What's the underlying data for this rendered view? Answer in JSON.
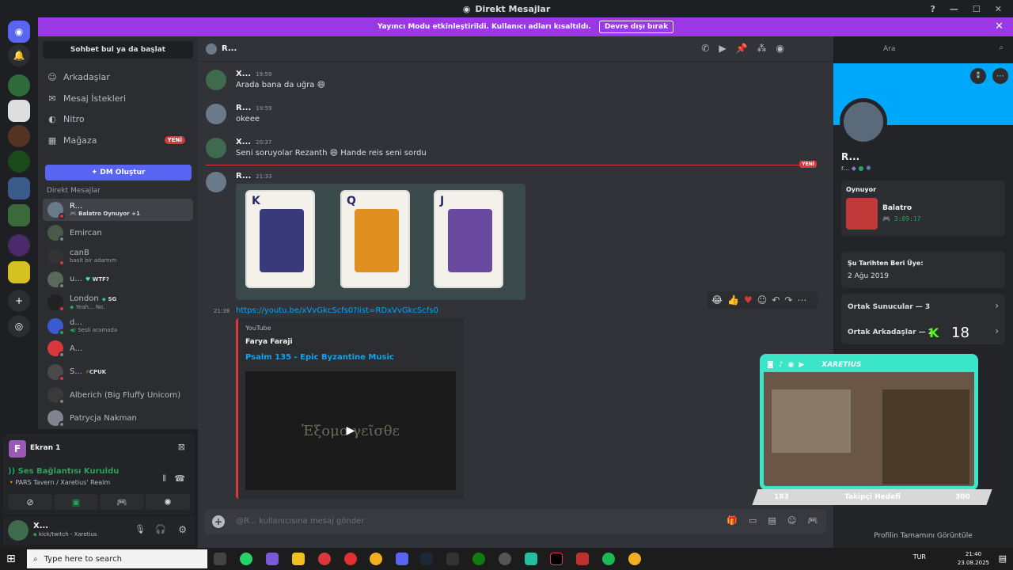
{
  "window": {
    "title": "Direkt Mesajlar"
  },
  "banner": {
    "text": "Yayıncı Modu etkinleştirildi. Kullanıcı adları kısaltıldı.",
    "button": "Devre dışı bırak"
  },
  "dm_sidebar": {
    "search": "Sohbet bul ya da başlat",
    "nav": [
      {
        "label": "Arkadaşlar",
        "icon": "friends-icon"
      },
      {
        "label": "Mesaj İstekleri",
        "icon": "mail-icon"
      },
      {
        "label": "Nitro",
        "icon": "nitro-icon"
      },
      {
        "label": "Mağaza",
        "icon": "shop-icon",
        "badge": "YENİ"
      }
    ],
    "create_dm": "DM Oluştur",
    "section_title": "Direkt Mesajlar",
    "items": [
      {
        "name": "R...",
        "sub": "Balatro Oynuyor",
        "extra": "+1",
        "selected": true
      },
      {
        "name": "Emircan",
        "sub": ""
      },
      {
        "name": "canB",
        "sub": "basit bir adamım"
      },
      {
        "name": "u...",
        "tag": "WTF?",
        "sub": ""
      },
      {
        "name": "London",
        "tag": "SG",
        "sub": "Yeah... No."
      },
      {
        "name": "d...",
        "sub": "Sesli aramada"
      },
      {
        "name": "A...",
        "sub": ""
      },
      {
        "name": "S...",
        "tag": "CPUK",
        "sub": ""
      },
      {
        "name": "Alberich (Big Fluffy Unicorn)",
        "sub": ""
      },
      {
        "name": "Patrycja Nakman",
        "sub": ""
      }
    ]
  },
  "voice": {
    "screen_label": "Ekran 1",
    "screen_letter": "F",
    "status": "Ses Bağlantısı Kuruldu",
    "channel": "PARS Tavern / Xaretius' Realm"
  },
  "user_panel": {
    "name": "X...",
    "status": "kick/twitch - Xaretius"
  },
  "chat": {
    "header_name": "R...",
    "messages": [
      {
        "author": "X...",
        "time": "19:59",
        "text": "Arada bana da uğra 😄"
      },
      {
        "author": "R...",
        "time": "19:59",
        "text": "okeee"
      },
      {
        "author": "X...",
        "time": "20:37",
        "text": "Seni soruyolar Rezanth 😄 Hande reis seni sordu"
      },
      {
        "author": "R...",
        "time": "21:33",
        "text": ""
      }
    ],
    "new_badge": "YENİ",
    "cards": [
      "K",
      "Q",
      "J"
    ],
    "link_time": "21:38",
    "link": "https://youtu.be/xVvGkcScfs0?list=RDxVvGkcScfs0",
    "embed": {
      "provider": "YouTube",
      "author": "Farya Faraji",
      "title": "Psalm 135 - Epic Byzantine Music",
      "video_text": "Ἐξομο  γεῖσθε"
    },
    "composer_placeholder": "@R... kullanıcısına mesaj gönder"
  },
  "top_search": {
    "placeholder": "Ara"
  },
  "profile": {
    "name": "R...",
    "short": "r...",
    "playing_header": "Oynuyor",
    "game": "Balatro",
    "game_time": "3:09:17",
    "member_header": "Şu Tarihten Beri Üye:",
    "member_date": "2 Ağu 2019",
    "mutual_servers": "Ortak Sunucular — 3",
    "mutual_friends": "Ortak Arkadaşlar — 2",
    "view_full": "Profilin Tamamını Görüntüle"
  },
  "stream_overlay": {
    "name": "XARETIUS",
    "left_num": "183",
    "goal": "Takipçi Hedefi",
    "right_num": "300",
    "kick_count": "18"
  },
  "taskbar": {
    "search": "Type here to search",
    "lang": "TUR",
    "time": "21:40",
    "date": "23.08.2025"
  },
  "colors": {
    "accent": "#5865f2",
    "banner": "#9b38e6",
    "profile_banner": "#00a8fc",
    "danger": "#da373c",
    "link": "#00a8fc"
  }
}
